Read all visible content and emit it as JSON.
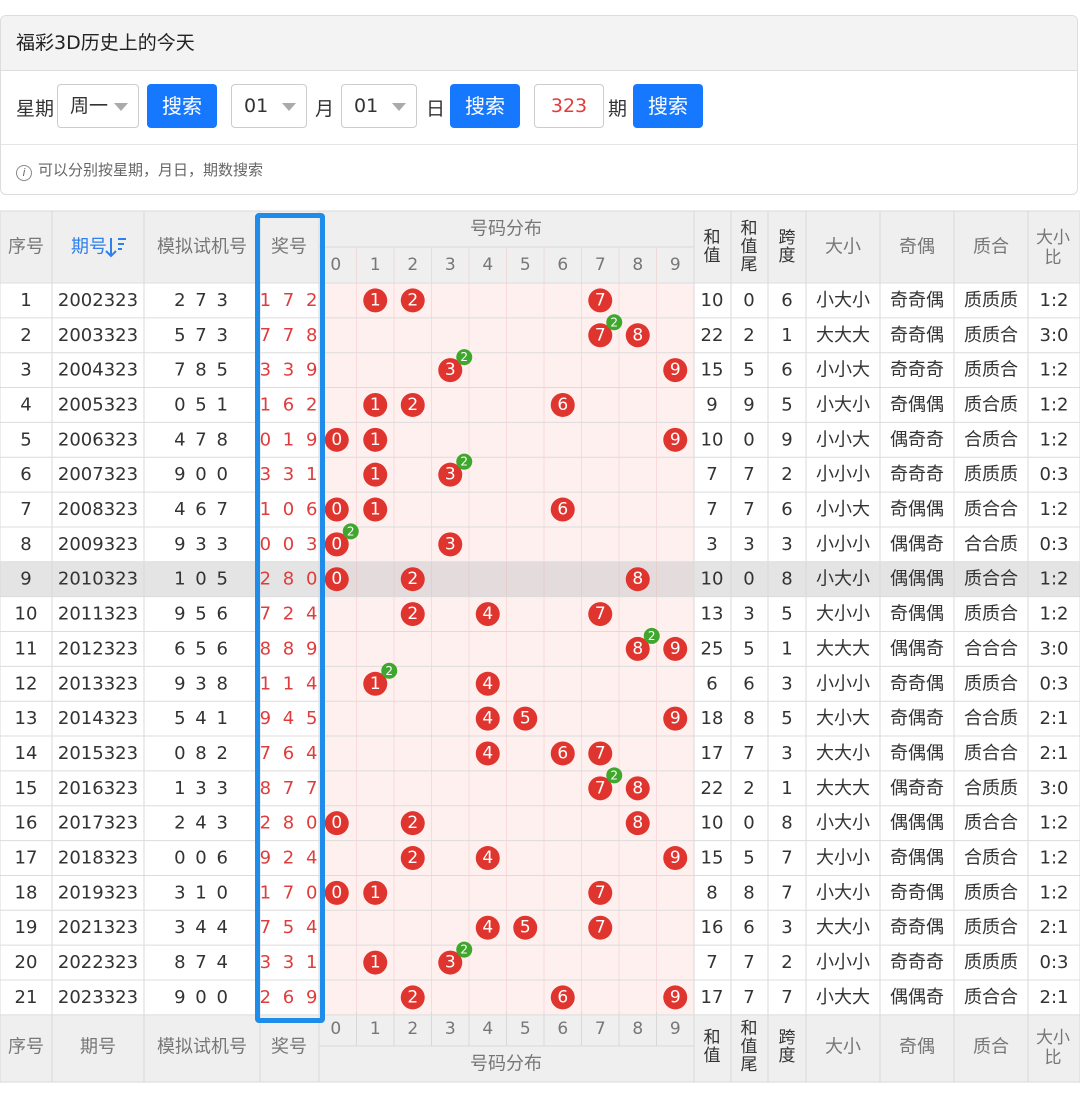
{
  "panel": {
    "title": "福彩3D历史上的今天",
    "week_label": "星期",
    "week_value": "周一",
    "search_label": "搜索",
    "month_value": "01",
    "month_label": "月",
    "day_value": "01",
    "day_label": "日",
    "issue_value": "323",
    "issue_label": "期",
    "tip": "可以分别按星期，月日，期数搜索",
    "tip_icon": "info-icon"
  },
  "table": {
    "headers": {
      "seq": "序号",
      "issue": "期号",
      "sim": "模拟试机号",
      "win": "奖号",
      "dist": "号码分布",
      "sum": "和值",
      "sum_tail": "和值尾",
      "span": "跨度",
      "size": "大小",
      "odd_even": "奇偶",
      "prime": "质合",
      "size_ratio": "大小比"
    },
    "digits": [
      "0",
      "1",
      "2",
      "3",
      "4",
      "5",
      "6",
      "7",
      "8",
      "9"
    ],
    "sort_icon": "sort-icon",
    "highlighted_row": 9,
    "rows": [
      {
        "seq": "1",
        "issue": "2002323",
        "sim": "2 7 3",
        "win": "1 7 2",
        "sum": "10",
        "tail": "0",
        "span": "6",
        "size": "小大小",
        "oe": "奇奇偶",
        "pr": "质质质",
        "ratio": "1:2"
      },
      {
        "seq": "2",
        "issue": "2003323",
        "sim": "5 7 3",
        "win": "7 7 8",
        "sum": "22",
        "tail": "2",
        "span": "1",
        "size": "大大大",
        "oe": "奇奇偶",
        "pr": "质质合",
        "ratio": "3:0"
      },
      {
        "seq": "3",
        "issue": "2004323",
        "sim": "7 8 5",
        "win": "3 3 9",
        "sum": "15",
        "tail": "5",
        "span": "6",
        "size": "小小大",
        "oe": "奇奇奇",
        "pr": "质质合",
        "ratio": "1:2"
      },
      {
        "seq": "4",
        "issue": "2005323",
        "sim": "0 5 1",
        "win": "1 6 2",
        "sum": "9",
        "tail": "9",
        "span": "5",
        "size": "小大小",
        "oe": "奇偶偶",
        "pr": "质合质",
        "ratio": "1:2"
      },
      {
        "seq": "5",
        "issue": "2006323",
        "sim": "4 7 8",
        "win": "0 1 9",
        "sum": "10",
        "tail": "0",
        "span": "9",
        "size": "小小大",
        "oe": "偶奇奇",
        "pr": "合质合",
        "ratio": "1:2"
      },
      {
        "seq": "6",
        "issue": "2007323",
        "sim": "9 0 0",
        "win": "3 3 1",
        "sum": "7",
        "tail": "7",
        "span": "2",
        "size": "小小小",
        "oe": "奇奇奇",
        "pr": "质质质",
        "ratio": "0:3"
      },
      {
        "seq": "7",
        "issue": "2008323",
        "sim": "4 6 7",
        "win": "1 0 6",
        "sum": "7",
        "tail": "7",
        "span": "6",
        "size": "小小大",
        "oe": "奇偶偶",
        "pr": "质合合",
        "ratio": "1:2"
      },
      {
        "seq": "8",
        "issue": "2009323",
        "sim": "9 3 3",
        "win": "0 0 3",
        "sum": "3",
        "tail": "3",
        "span": "3",
        "size": "小小小",
        "oe": "偶偶奇",
        "pr": "合合质",
        "ratio": "0:3"
      },
      {
        "seq": "9",
        "issue": "2010323",
        "sim": "1 0 5",
        "win": "2 8 0",
        "sum": "10",
        "tail": "0",
        "span": "8",
        "size": "小大小",
        "oe": "偶偶偶",
        "pr": "质合合",
        "ratio": "1:2"
      },
      {
        "seq": "10",
        "issue": "2011323",
        "sim": "9 5 6",
        "win": "7 2 4",
        "sum": "13",
        "tail": "3",
        "span": "5",
        "size": "大小小",
        "oe": "奇偶偶",
        "pr": "质质合",
        "ratio": "1:2"
      },
      {
        "seq": "11",
        "issue": "2012323",
        "sim": "6 5 6",
        "win": "8 8 9",
        "sum": "25",
        "tail": "5",
        "span": "1",
        "size": "大大大",
        "oe": "偶偶奇",
        "pr": "合合合",
        "ratio": "3:0"
      },
      {
        "seq": "12",
        "issue": "2013323",
        "sim": "9 3 8",
        "win": "1 1 4",
        "sum": "6",
        "tail": "6",
        "span": "3",
        "size": "小小小",
        "oe": "奇奇偶",
        "pr": "质质合",
        "ratio": "0:3"
      },
      {
        "seq": "13",
        "issue": "2014323",
        "sim": "5 4 1",
        "win": "9 4 5",
        "sum": "18",
        "tail": "8",
        "span": "5",
        "size": "大小大",
        "oe": "奇偶奇",
        "pr": "合合质",
        "ratio": "2:1"
      },
      {
        "seq": "14",
        "issue": "2015323",
        "sim": "0 8 2",
        "win": "7 6 4",
        "sum": "17",
        "tail": "7",
        "span": "3",
        "size": "大大小",
        "oe": "奇偶偶",
        "pr": "质合合",
        "ratio": "2:1"
      },
      {
        "seq": "15",
        "issue": "2016323",
        "sim": "1 3 3",
        "win": "8 7 7",
        "sum": "22",
        "tail": "2",
        "span": "1",
        "size": "大大大",
        "oe": "偶奇奇",
        "pr": "合质质",
        "ratio": "3:0"
      },
      {
        "seq": "16",
        "issue": "2017323",
        "sim": "2 4 3",
        "win": "2 8 0",
        "sum": "10",
        "tail": "0",
        "span": "8",
        "size": "小大小",
        "oe": "偶偶偶",
        "pr": "质合合",
        "ratio": "1:2"
      },
      {
        "seq": "17",
        "issue": "2018323",
        "sim": "0 0 6",
        "win": "9 2 4",
        "sum": "15",
        "tail": "5",
        "span": "7",
        "size": "大小小",
        "oe": "奇偶偶",
        "pr": "合质合",
        "ratio": "1:2"
      },
      {
        "seq": "18",
        "issue": "2019323",
        "sim": "3 1 0",
        "win": "1 7 0",
        "sum": "8",
        "tail": "8",
        "span": "7",
        "size": "小大小",
        "oe": "奇奇偶",
        "pr": "质质合",
        "ratio": "1:2"
      },
      {
        "seq": "19",
        "issue": "2021323",
        "sim": "3 4 4",
        "win": "7 5 4",
        "sum": "16",
        "tail": "6",
        "span": "3",
        "size": "大大小",
        "oe": "奇奇偶",
        "pr": "质质合",
        "ratio": "2:1"
      },
      {
        "seq": "20",
        "issue": "2022323",
        "sim": "8 7 4",
        "win": "3 3 1",
        "sum": "7",
        "tail": "7",
        "span": "2",
        "size": "小小小",
        "oe": "奇奇奇",
        "pr": "质质质",
        "ratio": "0:3"
      },
      {
        "seq": "21",
        "issue": "2023323",
        "sim": "9 0 0",
        "win": "2 6 9",
        "sum": "17",
        "tail": "7",
        "span": "7",
        "size": "小大大",
        "oe": "偶偶奇",
        "pr": "质合合",
        "ratio": "2:1"
      }
    ]
  },
  "colors": {
    "accent": "#1677ff",
    "ball": "#e0342e",
    "repeat_badge": "#3fa72d",
    "win_text": "#e03c3c",
    "highlight": "#1e8ce8"
  }
}
